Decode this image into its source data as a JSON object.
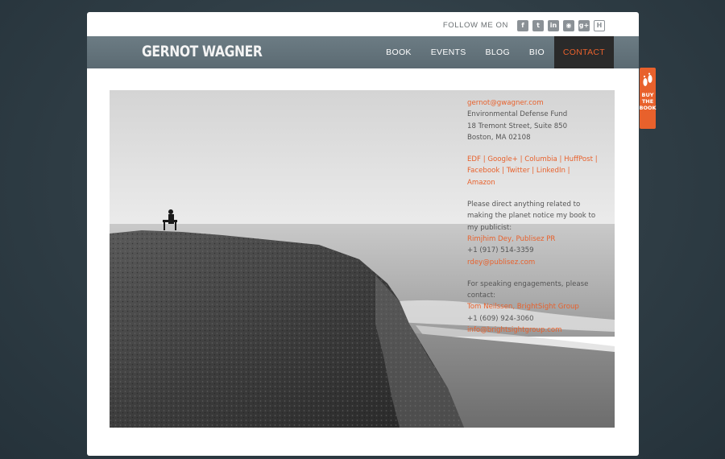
{
  "follow": {
    "label": "FOLLOW ME ON",
    "icons": [
      {
        "name": "facebook-icon",
        "glyph": "f"
      },
      {
        "name": "twitter-icon",
        "glyph": "t"
      },
      {
        "name": "linkedin-icon",
        "glyph": "in"
      },
      {
        "name": "rss-icon",
        "glyph": "◉"
      },
      {
        "name": "google-plus-icon",
        "glyph": "g+"
      },
      {
        "name": "huffpost-icon",
        "glyph": "H"
      }
    ]
  },
  "brand": {
    "name": "GERNOT WAGNER"
  },
  "nav": {
    "items": [
      {
        "label": "BOOK"
      },
      {
        "label": "EVENTS"
      },
      {
        "label": "BLOG"
      },
      {
        "label": "BIO"
      },
      {
        "label": "CONTACT"
      }
    ],
    "active": "CONTACT"
  },
  "contact": {
    "email": "gernot@gwagner.com",
    "org": "Environmental Defense Fund",
    "street": "18 Tremont Street, Suite 850",
    "city": "Boston, MA 02108",
    "links": {
      "edf": "EDF",
      "google": "Google+",
      "columbia": "Columbia",
      "huffpost": "HuffPost",
      "facebook": "Facebook",
      "twitter": "Twitter",
      "linkedin": "LinkedIn",
      "amazon": "Amazon",
      "sep": " | "
    },
    "publicist_note": "Please direct anything related to making the planet notice my book to my publicist:",
    "publicist_name": "Rimjhim Dey, Publisez PR",
    "publicist_phone": "+1 (917) 514-3359",
    "publicist_email": "rdey@publisez.com",
    "speaking_note": "For speaking engagements, please contact:",
    "speaking_name": "Tom Neilssen, BrightSight Group",
    "speaking_phone": "+1 (609) 924-3060",
    "speaking_email": "info@brightsightgroup.com"
  },
  "buy_tab": {
    "line1": "BUY",
    "line2": "THE",
    "line3": "BOOK"
  },
  "colors": {
    "accent": "#e8612c",
    "header": "#5f6e76",
    "background": "#2f3d45"
  }
}
